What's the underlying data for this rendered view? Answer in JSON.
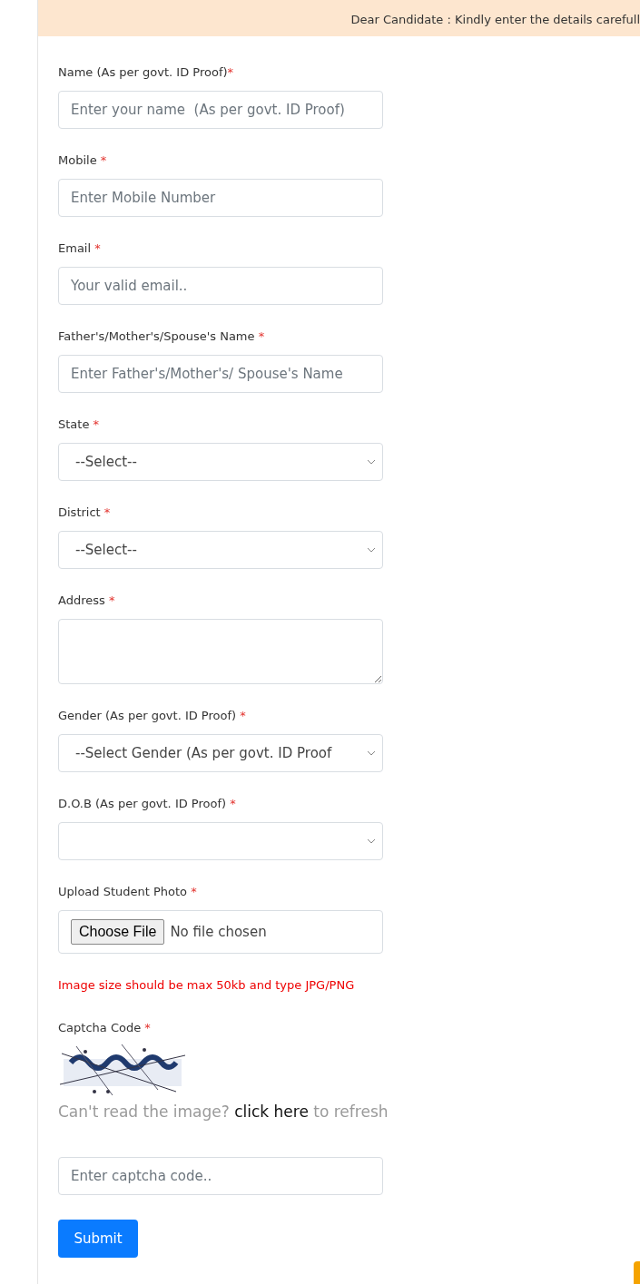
{
  "notice": "Dear Candidate : Kindly enter the details carefull",
  "fields": [
    {
      "kind": "text",
      "label": "Name (As per govt. ID Proof)",
      "mark": "*",
      "placeholder": "Enter your name  (As per govt. ID Proof)"
    },
    {
      "kind": "text",
      "label": "Mobile ",
      "mark": "*",
      "placeholder": "Enter Mobile Number"
    },
    {
      "kind": "text",
      "label": "Email ",
      "mark": "*",
      "placeholder": "Your valid email.."
    },
    {
      "kind": "text",
      "label": "Father's/Mother's/Spouse's Name ",
      "mark": "*",
      "placeholder": "Enter Father's/Mother's/ Spouse's Name"
    },
    {
      "kind": "select",
      "label": "State ",
      "mark": "*",
      "value": "--Select--"
    },
    {
      "kind": "select",
      "label": "District ",
      "mark": "*",
      "value": "--Select--"
    },
    {
      "kind": "textarea",
      "label": "Address ",
      "mark": "*"
    },
    {
      "kind": "select",
      "label": "Gender (As per govt. ID Proof) ",
      "mark": "*",
      "value": "--Select Gender (As per govt. ID Proof"
    },
    {
      "kind": "select",
      "label": "D.O.B (As per govt. ID Proof) ",
      "mark": "*"
    },
    {
      "kind": "file",
      "label": "Upload Student Photo ",
      "mark": "*",
      "button": "Choose File",
      "status": "No file chosen"
    }
  ],
  "file_hint": "Image size should be max 50kb and type JPG/PNG",
  "captcha": {
    "label": "Captcha Code ",
    "mark": "*",
    "refresh_before": "Can't read the image? ",
    "refresh_link": "click here",
    "refresh_after": " to refresh",
    "placeholder": "Enter captcha code.."
  },
  "submit": "Submit"
}
